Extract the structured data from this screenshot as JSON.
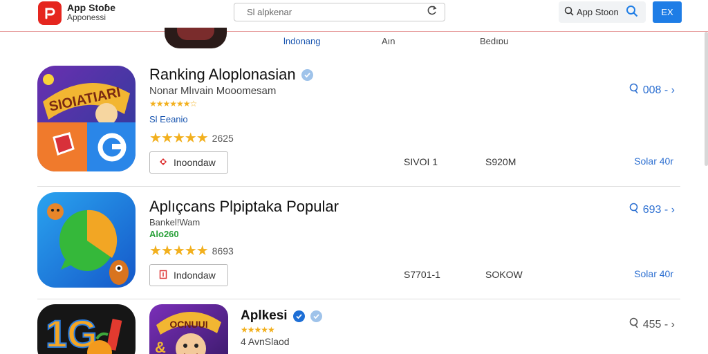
{
  "header": {
    "logo_title": "App Stoɓe",
    "logo_sub": "Apponessi",
    "search_placeholder": "Sl alpkenar",
    "store_search_label": "App Stoon",
    "button_label": "ΕΧ"
  },
  "subnav": [
    "lndonang",
    "Aın",
    "Βedıɒu"
  ],
  "colors": {
    "accent": "#1e7de6",
    "brand": "#e5261f",
    "star": "#f2b01e",
    "link": "#2c6fd1"
  },
  "apps": [
    {
      "title": "Ranking Aloplonasian",
      "subtitle": "Nonar Mlıvain Mooomesam",
      "small_stars": "★★★★★★☆",
      "category": "Sl Eeanio",
      "stars": "★★★★★",
      "rating_count": "2625",
      "button_label": "Inoondaw",
      "stat1": "SIVOI  1",
      "stat2": "S920M",
      "rank": "008 - ›",
      "link": "Solar 40r"
    },
    {
      "title": "Aplıçcans Plpiptaka Popular",
      "subtitle": "Bankel!Wam",
      "category": "Alo260",
      "stars": "★★★★★",
      "rating_count": "8693",
      "button_label": "Indondaw",
      "stat1": "S7701-1",
      "stat2": "SOKOW",
      "rank": "693 - ›",
      "link": "Solar 40r"
    },
    {
      "title": "Aplkesi",
      "small_stars": "★★★★★",
      "subtitle": "4 AvnSlaod",
      "rank": "455 - ›"
    }
  ]
}
